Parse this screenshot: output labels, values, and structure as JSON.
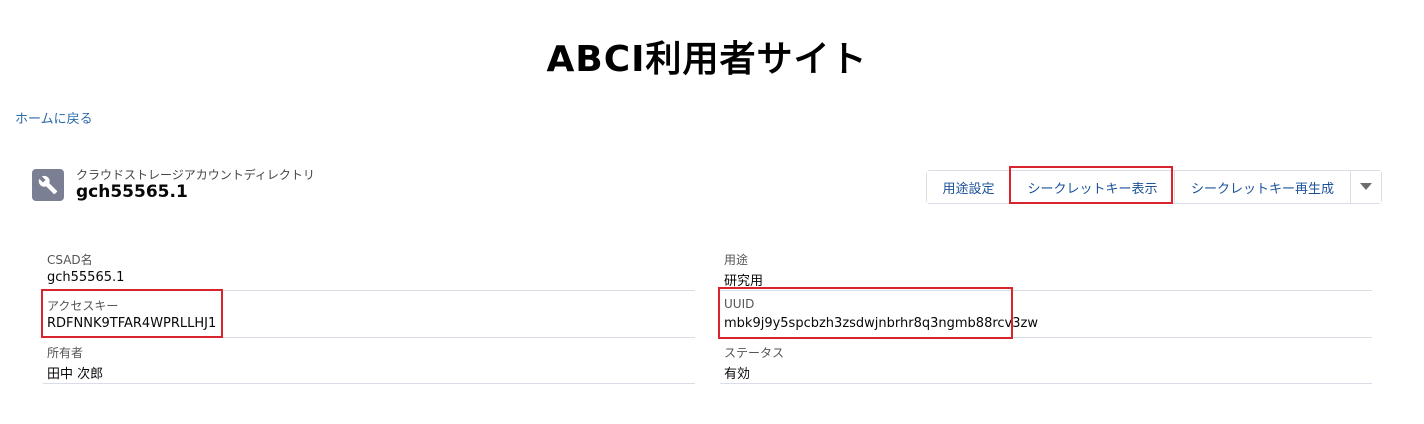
{
  "site": {
    "title": "ABCI利用者サイト"
  },
  "nav": {
    "home_link": "ホームに戻る"
  },
  "record": {
    "icon": "wrench-icon",
    "type_label": "クラウドストレージアカウントディレクトリ",
    "name": "gch55565.1"
  },
  "actions": {
    "usage_setting": "用途設定",
    "show_secret_key": "シークレットキー表示",
    "regenerate_secret_key": "シークレットキー再生成",
    "menu_icon": "chevron-down-icon"
  },
  "details": {
    "csad_name": {
      "label": "CSAD名",
      "value": "gch55565.1"
    },
    "access_key": {
      "label": "アクセスキー",
      "value": "RDFNNK9TFAR4WPRLLHJ1"
    },
    "owner": {
      "label": "所有者",
      "value": "田中 次郎"
    },
    "usage": {
      "label": "用途",
      "value": "研究用"
    },
    "uuid": {
      "label": "UUID",
      "value": "mbk9j9y5spcbzh3zsdwjnbrhr8q3ngmb88rcv3zw"
    },
    "status": {
      "label": "ステータス",
      "value": "有効"
    }
  },
  "colors": {
    "link": "#2b6bab",
    "highlight": "#d8242c",
    "icon_bg": "#7a7f93"
  }
}
